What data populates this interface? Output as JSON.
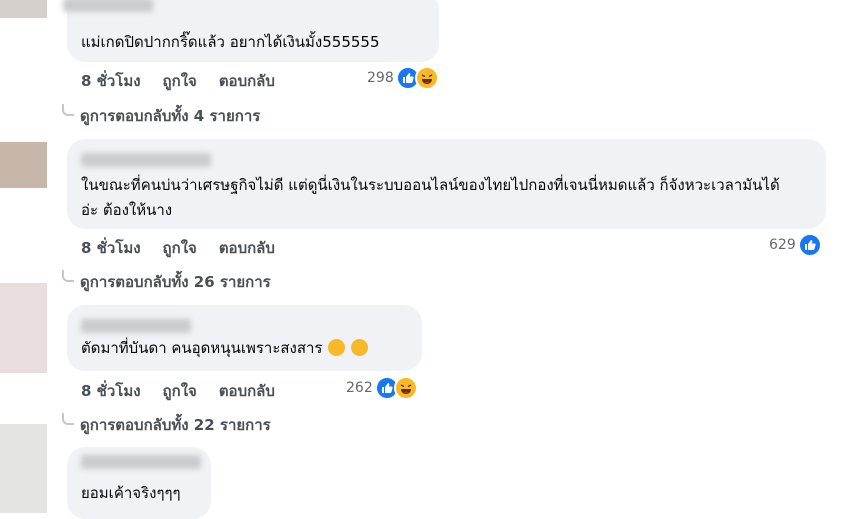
{
  "comments": [
    {
      "text": "แม่เกดปิดปากกริ๊ดแล้ว อยากได้เงินมั้ง555555",
      "time": "8 ชั่วโมง",
      "like_label": "ถูกใจ",
      "reply_label": "ตอบกลับ",
      "reaction_count": "298",
      "reactions": [
        "like-icon",
        "haha-icon"
      ],
      "replies_label": "ดูการตอบกลับทั้ง 4 รายการ"
    },
    {
      "text": "ในขณะที่คนบ่นว่าเศรษฐกิจไม่ดี แต่ดูนี่เงินในระบบออนไลน์ของไทยไปกองที่เจนนี่หมดแล้ว ก็จังหวะเวลามันได้อ่ะ ต้องให้นาง",
      "time": "8 ชั่วโมง",
      "like_label": "ถูกใจ",
      "reply_label": "ตอบกลับ",
      "reaction_count": "629",
      "reactions": [
        "like-icon"
      ],
      "replies_label": "ดูการตอบกลับทั้ง 26 รายการ"
    },
    {
      "text": "ตัดมาที่บันดา คนอุดหนุนเพราะสงสาร",
      "time": "8 ชั่วโมง",
      "like_label": "ถูกใจ",
      "reply_label": "ตอบกลับ",
      "reaction_count": "262",
      "reactions": [
        "like-icon",
        "haha-icon"
      ],
      "replies_label": "ดูการตอบกลับทั้ง 22 รายการ"
    },
    {
      "text": "ยอมเค้าจริงๆๆๆ"
    }
  ],
  "colors": {
    "bubble": "#f0f2f5",
    "like_blue": "#1877f2",
    "haha_yellow": "#f7b928",
    "meta_text": "#4b4f56"
  }
}
